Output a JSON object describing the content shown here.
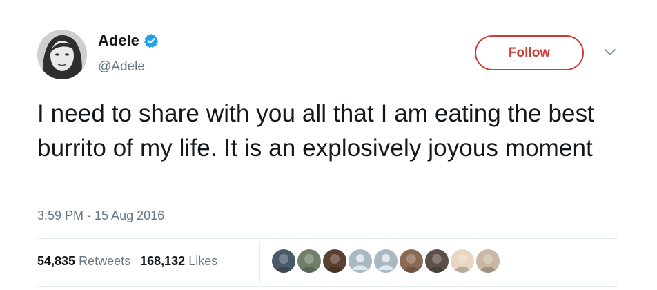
{
  "user": {
    "display_name": "Adele",
    "handle": "@Adele",
    "verified": true,
    "avatar_icon": "user-avatar"
  },
  "actions": {
    "follow_label": "Follow",
    "menu_icon": "chevron-down-icon"
  },
  "tweet": {
    "text": "I need to share with you all that I am eating the best burrito of my life. It is an explosively joyous moment",
    "timestamp": "3:59 PM - 15 Aug 2016"
  },
  "stats": {
    "retweets_count": "54,835",
    "retweets_label": "Retweets",
    "likes_count": "168,132",
    "likes_label": "Likes"
  },
  "likers": [
    {
      "color": "#4a5a6a"
    },
    {
      "color": "#6f7f6a"
    },
    {
      "color": "#5a4030"
    },
    {
      "color": "#aab8c2"
    },
    {
      "color": "#aab8c2"
    },
    {
      "color": "#8a6a55"
    },
    {
      "color": "#5c5048"
    },
    {
      "color": "#e8d6c0"
    },
    {
      "color": "#c9b6a3"
    }
  ],
  "colors": {
    "accent": "#cc3c35",
    "verified": "#1da1f2",
    "muted": "#657786",
    "text": "#14171a"
  }
}
